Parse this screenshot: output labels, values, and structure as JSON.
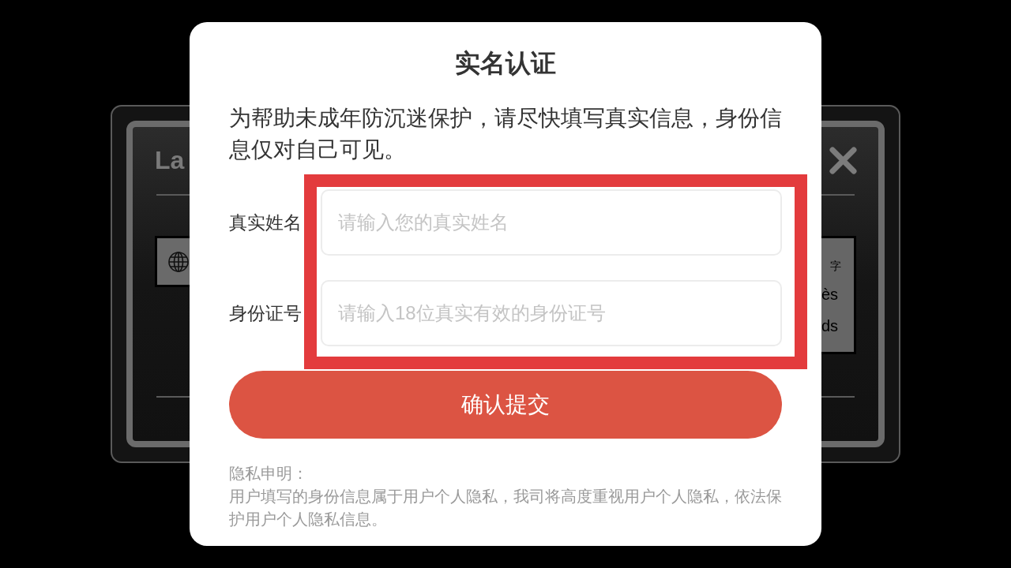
{
  "background_dialog": {
    "title": "La",
    "option_lines": [
      "字",
      "ès",
      "ds"
    ]
  },
  "modal": {
    "title": "实名认证",
    "description": "为帮助未成年防沉迷保护，请尽快填写真实信息，身份信息仅对自己可见。",
    "fields_highlighted": true,
    "fields": [
      {
        "label": "真实姓名",
        "placeholder": "请输入您的真实姓名"
      },
      {
        "label": "身份证号",
        "placeholder": "请输入18位真实有效的身份证号"
      }
    ],
    "submit_button": "确认提交",
    "privacy": {
      "heading": "隐私申明：",
      "text": "用户填写的身份信息属于用户个人隐私，我司将高度重视用户个人隐私，依法保护用户个人隐私信息。"
    }
  }
}
